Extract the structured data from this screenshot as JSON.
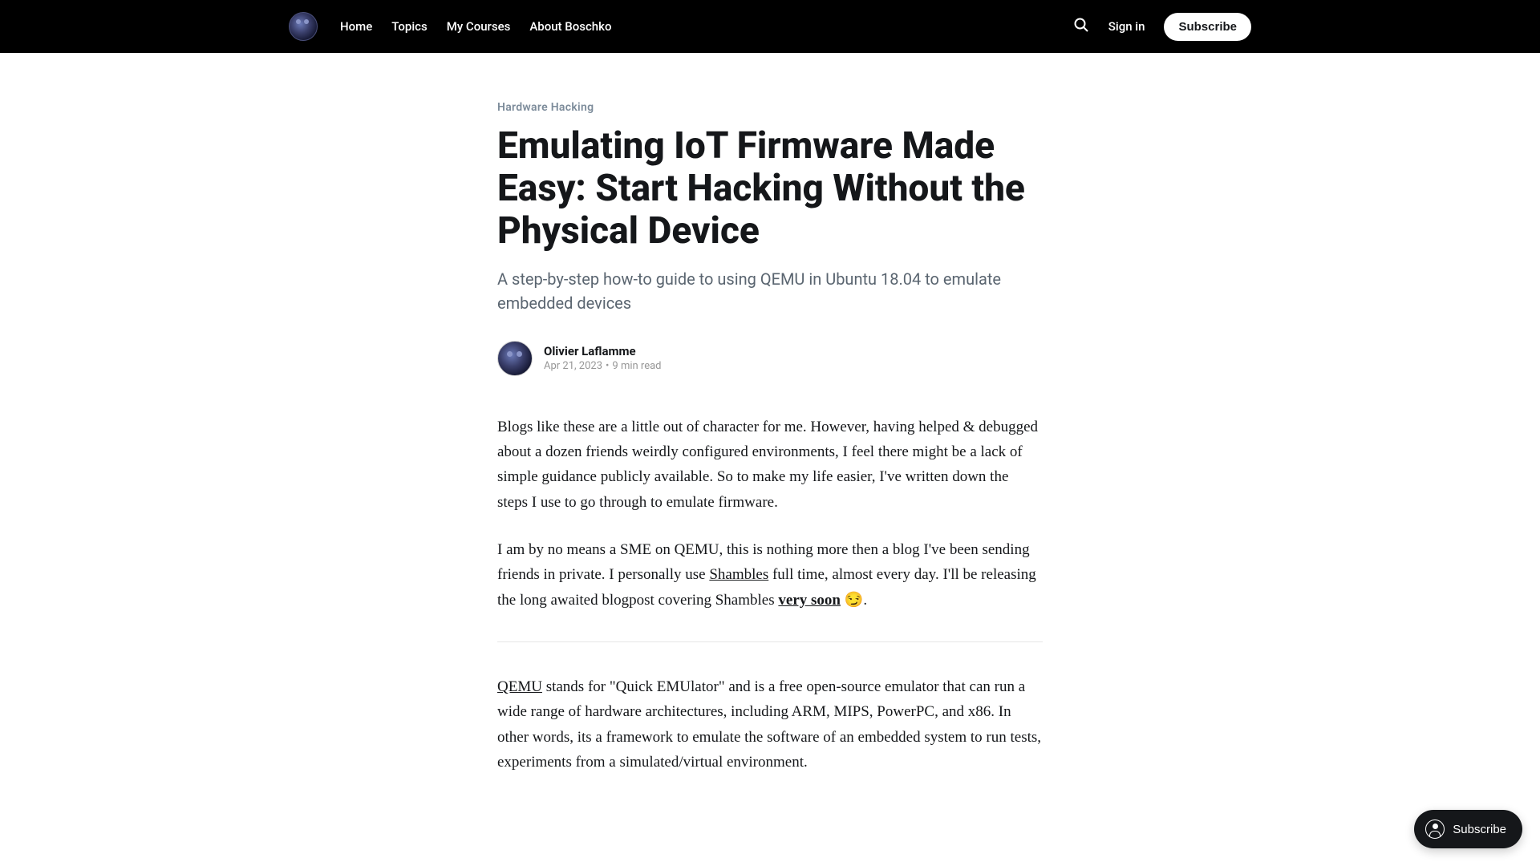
{
  "header": {
    "nav": [
      "Home",
      "Topics",
      "My Courses",
      "About Boschko"
    ],
    "signin": "Sign in",
    "subscribe": "Subscribe"
  },
  "article": {
    "category": "Hardware Hacking",
    "title": "Emulating IoT Firmware Made Easy: Start Hacking Without the Physical Device",
    "subtitle": "A step-by-step how-to guide to using QEMU in Ubuntu 18.04 to emulate embedded devices",
    "author": "Olivier Laflamme",
    "date": "Apr 21, 2023",
    "readtime": "9 min read",
    "p1_a": "Blogs like these are a little out of character for me. However, having helped & debugged about a dozen friends weirdly configured environments, I feel there might be a lack of simple guidance publicly available. So to make my life easier, I've written down the steps I use to go through to emulate firmware.",
    "p2_a": "I am by no means a SME on QEMU, this is nothing more then a blog I've been sending friends in private. I personally use ",
    "p2_link1": "Shambles",
    "p2_b": " full time, almost every day. I'll be releasing the long awaited blogpost covering Shambles ",
    "p2_em": "very soon",
    "p2_c": " 😏.",
    "p3_link1": "QEMU",
    "p3_a": " stands for \"Quick EMUlator\" and is a free open-source emulator that can run a wide range of hardware architectures, including ARM, MIPS, PowerPC, and x86. In other words, its a framework to emulate the software of an embedded system to run tests, experiments from a simulated/virtual environment."
  },
  "portal": {
    "label": "Subscribe"
  }
}
